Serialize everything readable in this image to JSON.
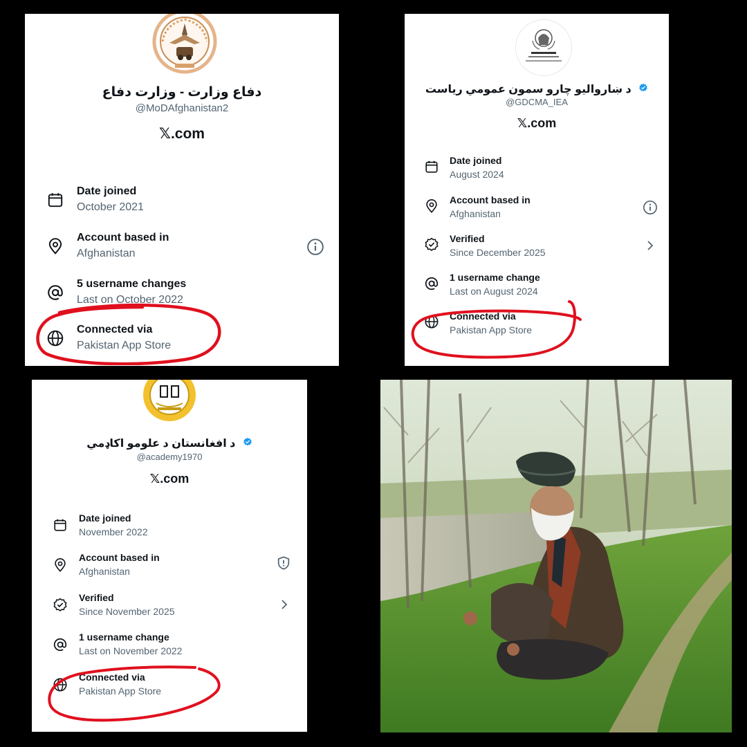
{
  "panels": [
    {
      "display_name": "دفاع وزارت - وزارت دفاع",
      "handle": "@MoDAfghanistan2",
      "site": "𝕏.com",
      "rows": [
        {
          "label": "Date joined",
          "value": "October 2021"
        },
        {
          "label": "Account based in",
          "value": "Afghanistan"
        },
        {
          "label": "5 username changes",
          "value": "Last on October 2022"
        },
        {
          "label": "Connected via",
          "value": "Pakistan App Store"
        }
      ]
    },
    {
      "display_name": "د ښاروالیو چارو سمون عمومي رياست",
      "handle": "@GDCMA_IEA",
      "site": "𝕏.com",
      "rows": [
        {
          "label": "Date joined",
          "value": "August 2024"
        },
        {
          "label": "Account based in",
          "value": "Afghanistan"
        },
        {
          "label": "Verified",
          "value": "Since December 2025"
        },
        {
          "label": "1 username change",
          "value": "Last on August 2024"
        },
        {
          "label": "Connected via",
          "value": "Pakistan App Store"
        }
      ]
    },
    {
      "display_name": "د افغانستان د علومو اکاډمي",
      "handle": "@academy1970",
      "site": "𝕏.com",
      "rows": [
        {
          "label": "Date joined",
          "value": "November 2022"
        },
        {
          "label": "Account based in",
          "value": "Afghanistan"
        },
        {
          "label": "Verified",
          "value": "Since November 2025"
        },
        {
          "label": "1 username change",
          "value": "Last on November 2022"
        },
        {
          "label": "Connected via",
          "value": "Pakistan App Store"
        }
      ]
    }
  ],
  "icons": {
    "date_joined": "calendar-icon",
    "account_based_in": "location-pin-icon",
    "username_changes": "at-sign-icon",
    "connected_via": "globe-icon",
    "verified": "verified-badge-icon"
  },
  "colors": {
    "verified_blue": "#1d9bf0",
    "annotation_red": "#e0101e",
    "secondary_text": "#536471"
  }
}
